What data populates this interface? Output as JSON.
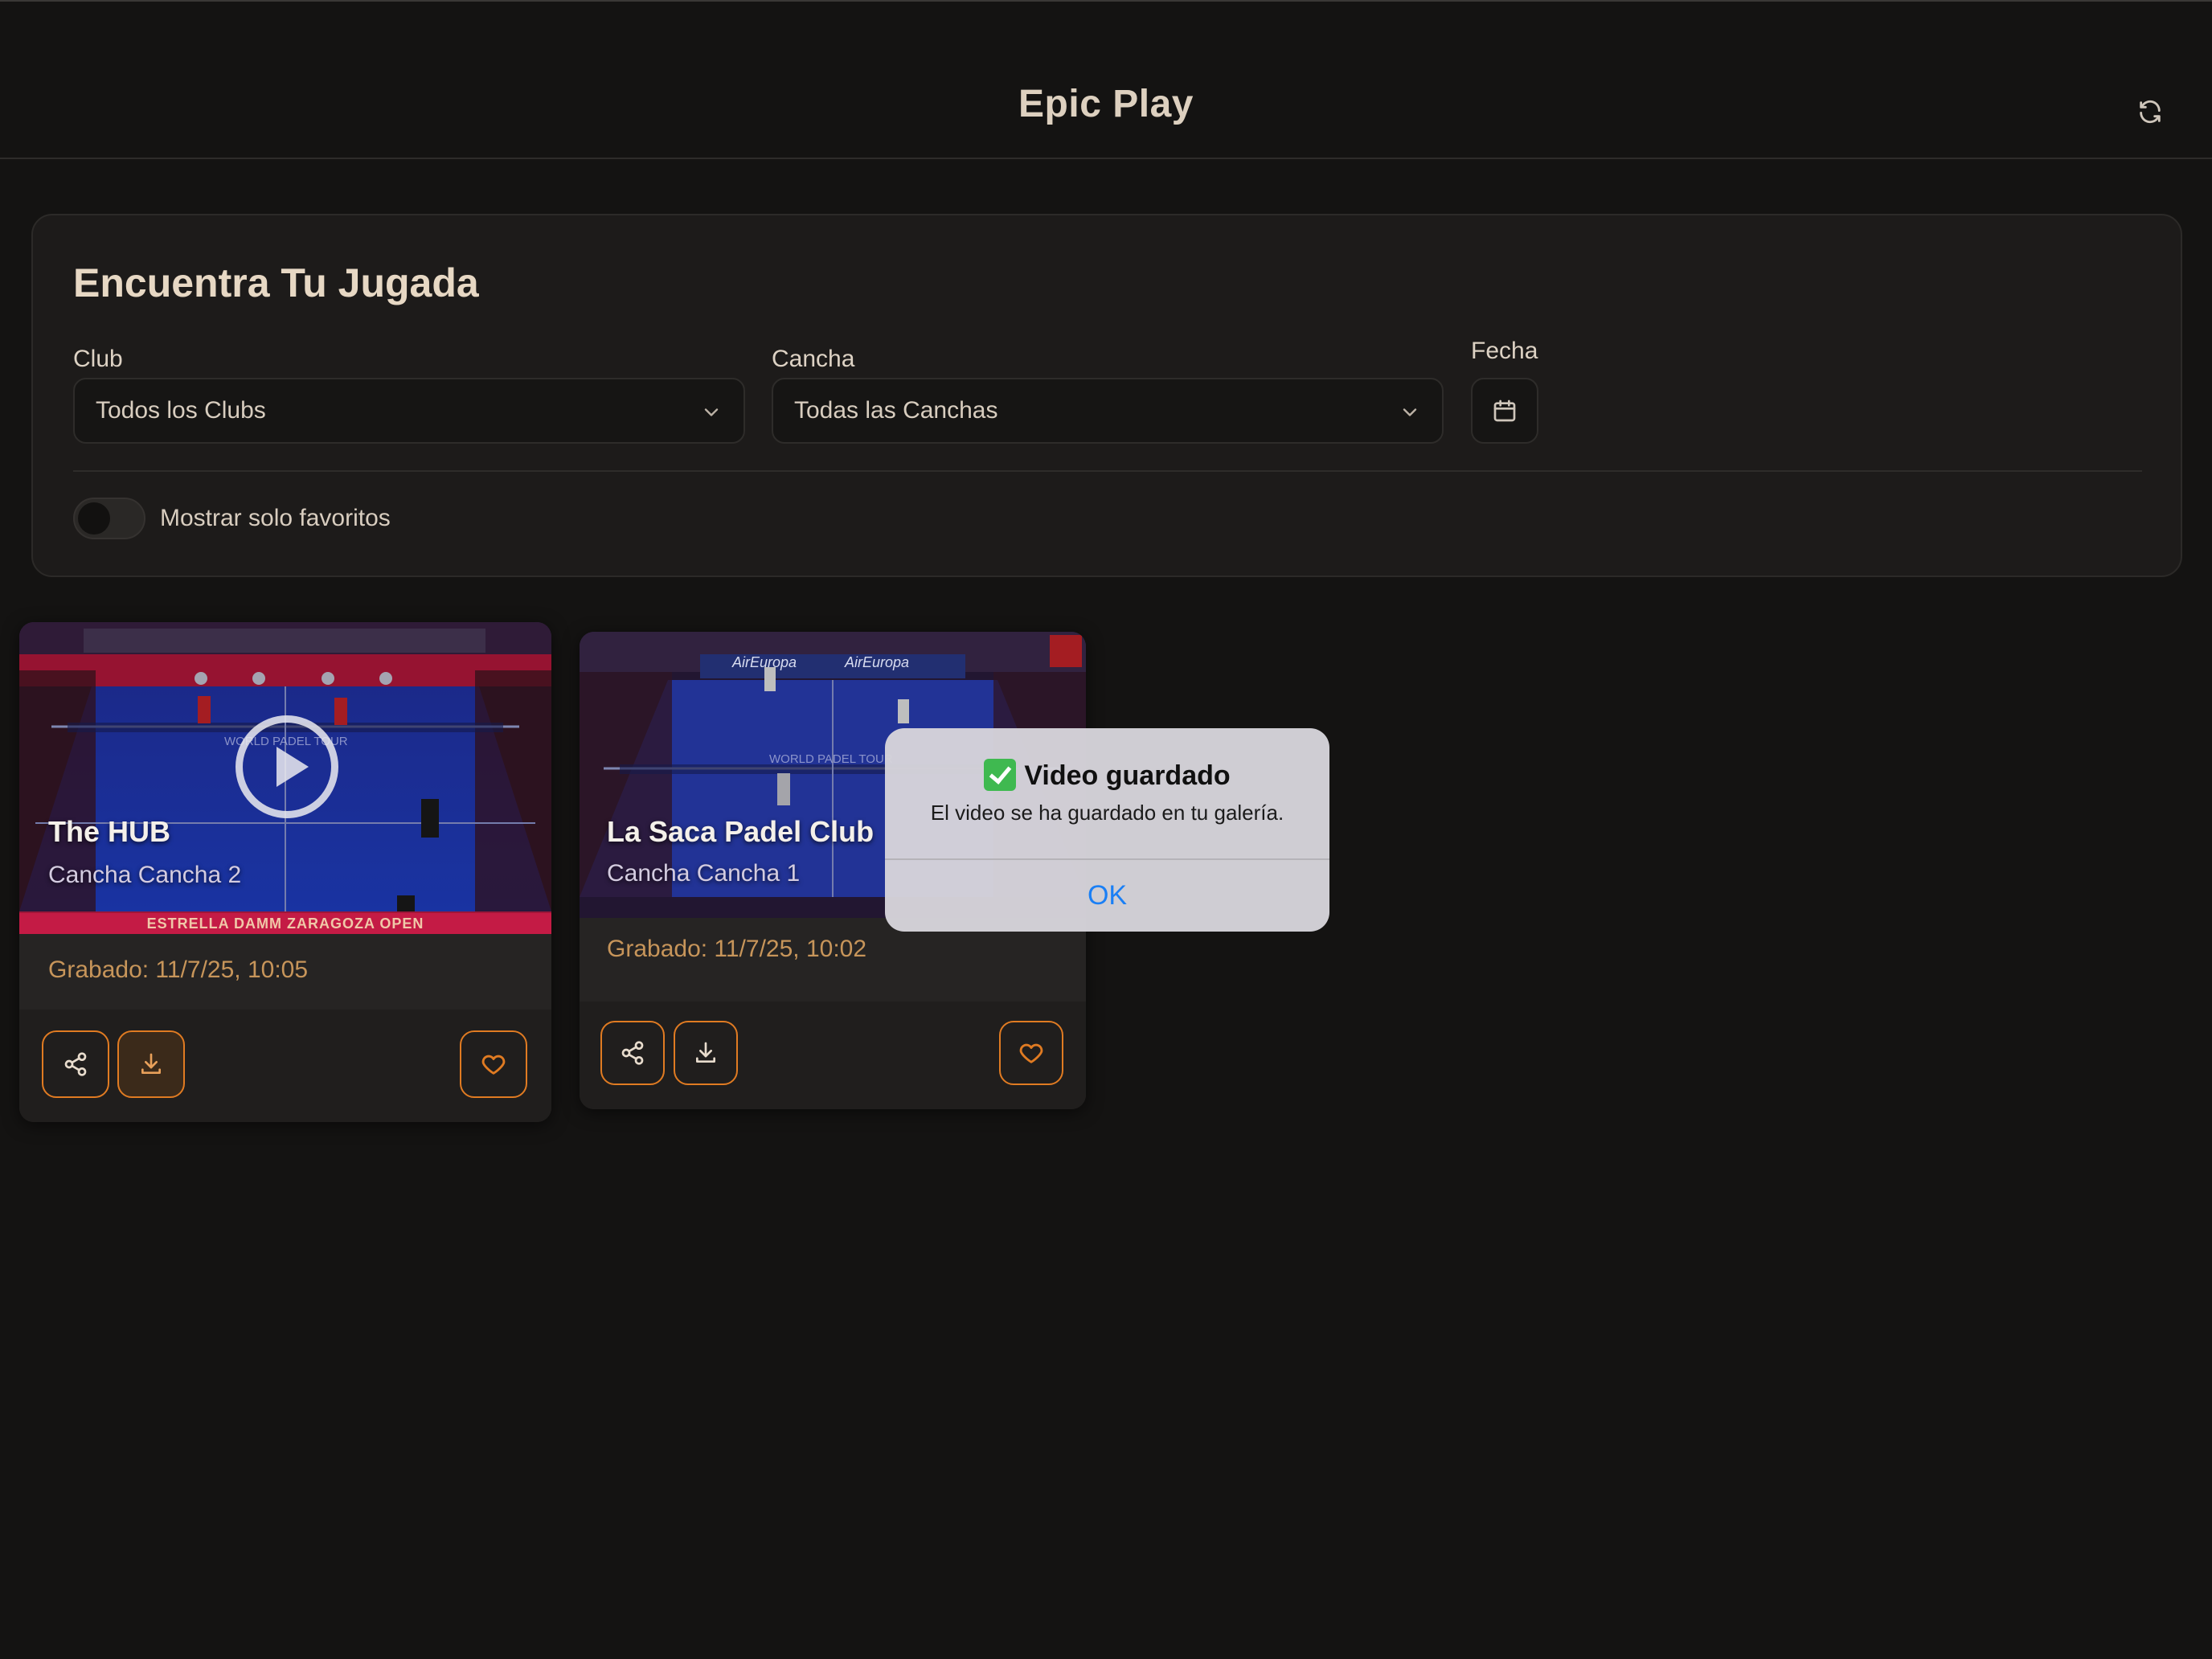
{
  "app": {
    "title": "Epic Play"
  },
  "filters": {
    "title": "Encuentra Tu Jugada",
    "club_label": "Club",
    "club_value": "Todos los Clubs",
    "court_label": "Cancha",
    "court_value": "Todas las Canchas",
    "date_label": "Fecha",
    "favorites_label": "Mostrar solo favoritos",
    "favorites_on": false
  },
  "videos": [
    {
      "club": "The HUB",
      "court": "Cancha Cancha 2",
      "recorded": "Grabado: 11/7/25, 10:05",
      "banner": "ESTRELLA DAMM ZARAGOZA OPEN",
      "watermark": "WORLD PADEL TOUR",
      "favorite": false
    },
    {
      "club": "La Saca Padel Club",
      "court": "Cancha Cancha 1",
      "recorded": "Grabado: 11/7/25, 10:02",
      "sponsor": "AirEuropa",
      "watermark": "WORLD PADEL TOUR",
      "favorite": false
    }
  ],
  "alert": {
    "title": "Video guardado",
    "message": "El video se ha guardado en tu galería.",
    "ok_label": "OK"
  },
  "colors": {
    "accent": "#e07b22",
    "background": "#141312",
    "panel": "#1d1b1a",
    "recorded_text": "#c7955a",
    "alert_button": "#1a7ff5"
  },
  "icons": {
    "refresh": "refresh-icon",
    "chevron": "chevron-down-icon",
    "calendar": "calendar-icon",
    "share": "share-icon",
    "download": "download-icon",
    "favorite": "heart-icon",
    "play": "play-icon",
    "check": "check-icon"
  }
}
